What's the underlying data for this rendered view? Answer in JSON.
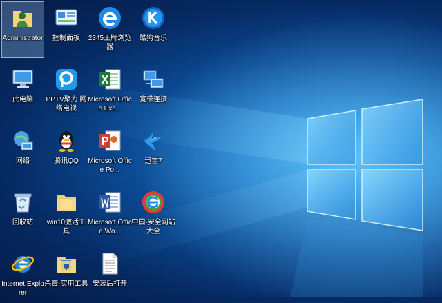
{
  "desktop": {
    "icons": [
      {
        "label": "Administrator",
        "icon": "user-folder-icon"
      },
      {
        "label": "控制面板",
        "icon": "control-panel-icon"
      },
      {
        "label": "2345王牌浏览器",
        "icon": "browser-2345-icon"
      },
      {
        "label": "酷狗音乐",
        "icon": "kugou-music-icon"
      },
      {
        "label": "此电脑",
        "icon": "computer-icon"
      },
      {
        "label": "PPTV聚力 网络电视",
        "icon": "pptv-icon"
      },
      {
        "label": "Microsoft Office Exc...",
        "icon": "excel-icon"
      },
      {
        "label": "宽带连接",
        "icon": "broadband-icon"
      },
      {
        "label": "网络",
        "icon": "network-icon"
      },
      {
        "label": "腾讯QQ",
        "icon": "qq-icon"
      },
      {
        "label": "Microsoft Office Po...",
        "icon": "powerpoint-icon"
      },
      {
        "label": "迅雷7",
        "icon": "xunlei-icon"
      },
      {
        "label": "回收站",
        "icon": "recycle-bin-icon"
      },
      {
        "label": "win10激活工具",
        "icon": "folder-icon"
      },
      {
        "label": "Microsoft Office Wo...",
        "icon": "word-icon"
      },
      {
        "label": "中国-安全网站大全",
        "icon": "ie-green-icon"
      },
      {
        "label": "Internet Explorer",
        "icon": "internet-explorer-icon"
      },
      {
        "label": "杀毒-实用工具",
        "icon": "folder-icon"
      },
      {
        "label": "安装后打开",
        "icon": "text-document-icon"
      }
    ]
  },
  "colors": {
    "wallpaper_glow": "#5cc8ff",
    "wallpaper_deep": "#041a44",
    "selection": "#aacdf0"
  }
}
